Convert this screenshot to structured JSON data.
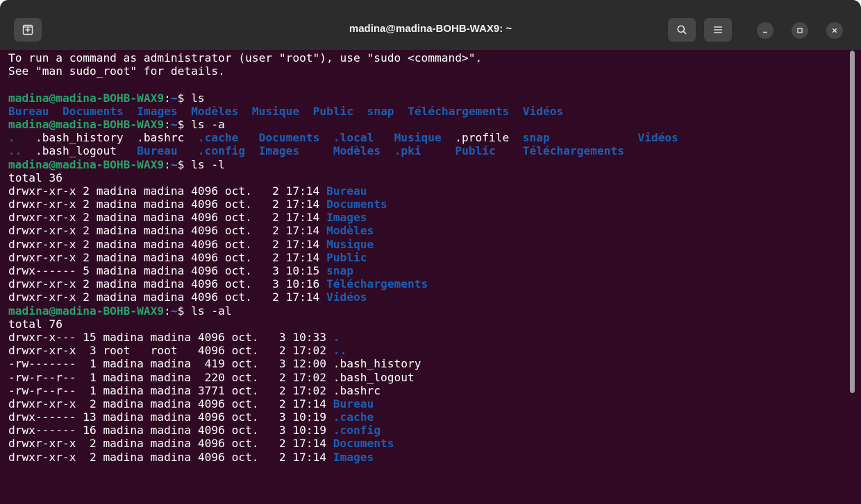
{
  "window": {
    "title": "madina@madina-BOHB-WAX9: ~"
  },
  "icons": {
    "new_tab": "new-tab-icon",
    "search": "search-icon",
    "menu": "hamburger-menu-icon",
    "minimize": "minimize-icon",
    "maximize": "maximize-icon",
    "close": "close-icon"
  },
  "colors": {
    "terminal_bg": "#300a24",
    "titlebar_bg": "#2c2c2c",
    "prompt_user": "#26a269",
    "prompt_path": "#3a79d8",
    "directory": "#1a5fb4",
    "text": "#ffffff"
  },
  "terminal": {
    "lines": [
      [
        {
          "t": "To run a command as administrator (user \"root\"), use \"sudo <command>\".",
          "c": "plain"
        }
      ],
      [
        {
          "t": "See \"man sudo_root\" for details.",
          "c": "plain"
        }
      ],
      [],
      [
        {
          "t": "madina@madina-BOHB-WAX9",
          "c": "prompt-user"
        },
        {
          "t": ":",
          "c": "plain"
        },
        {
          "t": "~",
          "c": "prompt-path"
        },
        {
          "t": "$ ls",
          "c": "plain"
        }
      ],
      [
        {
          "t": "Bureau",
          "c": "dir"
        },
        {
          "t": "  ",
          "c": "plain"
        },
        {
          "t": "Documents",
          "c": "dir"
        },
        {
          "t": "  ",
          "c": "plain"
        },
        {
          "t": "Images",
          "c": "dir"
        },
        {
          "t": "  ",
          "c": "plain"
        },
        {
          "t": "Modèles",
          "c": "dir"
        },
        {
          "t": "  ",
          "c": "plain"
        },
        {
          "t": "Musique",
          "c": "dir"
        },
        {
          "t": "  ",
          "c": "plain"
        },
        {
          "t": "Public",
          "c": "dir"
        },
        {
          "t": "  ",
          "c": "plain"
        },
        {
          "t": "snap",
          "c": "dir"
        },
        {
          "t": "  ",
          "c": "plain"
        },
        {
          "t": "Téléchargements",
          "c": "dir"
        },
        {
          "t": "  ",
          "c": "plain"
        },
        {
          "t": "Vidéos",
          "c": "dir"
        }
      ],
      [
        {
          "t": "madina@madina-BOHB-WAX9",
          "c": "prompt-user"
        },
        {
          "t": ":",
          "c": "plain"
        },
        {
          "t": "~",
          "c": "prompt-path"
        },
        {
          "t": "$ ls -a",
          "c": "plain"
        }
      ],
      [
        {
          "t": ".",
          "c": "dir"
        },
        {
          "t": "   .bash_history  .bashrc  ",
          "c": "plain"
        },
        {
          "t": ".cache",
          "c": "dir"
        },
        {
          "t": "   ",
          "c": "plain"
        },
        {
          "t": "Documents",
          "c": "dir"
        },
        {
          "t": "  ",
          "c": "plain"
        },
        {
          "t": ".local",
          "c": "dir"
        },
        {
          "t": "   ",
          "c": "plain"
        },
        {
          "t": "Musique",
          "c": "dir"
        },
        {
          "t": "  .profile  ",
          "c": "plain"
        },
        {
          "t": "snap",
          "c": "dir"
        },
        {
          "t": "             ",
          "c": "plain"
        },
        {
          "t": "Vidéos",
          "c": "dir"
        }
      ],
      [
        {
          "t": "..",
          "c": "dir"
        },
        {
          "t": "  .bash_logout   ",
          "c": "plain"
        },
        {
          "t": "Bureau",
          "c": "dir"
        },
        {
          "t": "   ",
          "c": "plain"
        },
        {
          "t": ".config",
          "c": "dir"
        },
        {
          "t": "  ",
          "c": "plain"
        },
        {
          "t": "Images",
          "c": "dir"
        },
        {
          "t": "     ",
          "c": "plain"
        },
        {
          "t": "Modèles",
          "c": "dir"
        },
        {
          "t": "  ",
          "c": "plain"
        },
        {
          "t": ".pki",
          "c": "dir"
        },
        {
          "t": "     ",
          "c": "plain"
        },
        {
          "t": "Public",
          "c": "dir"
        },
        {
          "t": "    ",
          "c": "plain"
        },
        {
          "t": "Téléchargements",
          "c": "dir"
        }
      ],
      [
        {
          "t": "madina@madina-BOHB-WAX9",
          "c": "prompt-user"
        },
        {
          "t": ":",
          "c": "plain"
        },
        {
          "t": "~",
          "c": "prompt-path"
        },
        {
          "t": "$ ls -l",
          "c": "plain"
        }
      ],
      [
        {
          "t": "total 36",
          "c": "plain"
        }
      ],
      [
        {
          "t": "drwxr-xr-x 2 madina madina 4096 oct.   2 17:14 ",
          "c": "plain"
        },
        {
          "t": "Bureau",
          "c": "dir"
        }
      ],
      [
        {
          "t": "drwxr-xr-x 2 madina madina 4096 oct.   2 17:14 ",
          "c": "plain"
        },
        {
          "t": "Documents",
          "c": "dir"
        }
      ],
      [
        {
          "t": "drwxr-xr-x 2 madina madina 4096 oct.   2 17:14 ",
          "c": "plain"
        },
        {
          "t": "Images",
          "c": "dir"
        }
      ],
      [
        {
          "t": "drwxr-xr-x 2 madina madina 4096 oct.   2 17:14 ",
          "c": "plain"
        },
        {
          "t": "Modèles",
          "c": "dir"
        }
      ],
      [
        {
          "t": "drwxr-xr-x 2 madina madina 4096 oct.   2 17:14 ",
          "c": "plain"
        },
        {
          "t": "Musique",
          "c": "dir"
        }
      ],
      [
        {
          "t": "drwxr-xr-x 2 madina madina 4096 oct.   2 17:14 ",
          "c": "plain"
        },
        {
          "t": "Public",
          "c": "dir"
        }
      ],
      [
        {
          "t": "drwx------ 5 madina madina 4096 oct.   3 10:15 ",
          "c": "plain"
        },
        {
          "t": "snap",
          "c": "dir"
        }
      ],
      [
        {
          "t": "drwxr-xr-x 2 madina madina 4096 oct.   3 10:16 ",
          "c": "plain"
        },
        {
          "t": "Téléchargements",
          "c": "dir"
        }
      ],
      [
        {
          "t": "drwxr-xr-x 2 madina madina 4096 oct.   2 17:14 ",
          "c": "plain"
        },
        {
          "t": "Vidéos",
          "c": "dir"
        }
      ],
      [
        {
          "t": "madina@madina-BOHB-WAX9",
          "c": "prompt-user"
        },
        {
          "t": ":",
          "c": "plain"
        },
        {
          "t": "~",
          "c": "prompt-path"
        },
        {
          "t": "$ ls -al",
          "c": "plain"
        }
      ],
      [
        {
          "t": "total 76",
          "c": "plain"
        }
      ],
      [
        {
          "t": "drwxr-x--- 15 madina madina 4096 oct.   3 10:33 ",
          "c": "plain"
        },
        {
          "t": ".",
          "c": "dir"
        }
      ],
      [
        {
          "t": "drwxr-xr-x  3 root   root   4096 oct.   2 17:02 ",
          "c": "plain"
        },
        {
          "t": "..",
          "c": "dir"
        }
      ],
      [
        {
          "t": "-rw-------  1 madina madina  419 oct.   3 12:00 .bash_history",
          "c": "plain"
        }
      ],
      [
        {
          "t": "-rw-r--r--  1 madina madina  220 oct.   2 17:02 .bash_logout",
          "c": "plain"
        }
      ],
      [
        {
          "t": "-rw-r--r--  1 madina madina 3771 oct.   2 17:02 .bashrc",
          "c": "plain"
        }
      ],
      [
        {
          "t": "drwxr-xr-x  2 madina madina 4096 oct.   2 17:14 ",
          "c": "plain"
        },
        {
          "t": "Bureau",
          "c": "dir"
        }
      ],
      [
        {
          "t": "drwx------ 13 madina madina 4096 oct.   3 10:19 ",
          "c": "plain"
        },
        {
          "t": ".cache",
          "c": "dir"
        }
      ],
      [
        {
          "t": "drwx------ 16 madina madina 4096 oct.   3 10:19 ",
          "c": "plain"
        },
        {
          "t": ".config",
          "c": "dir"
        }
      ],
      [
        {
          "t": "drwxr-xr-x  2 madina madina 4096 oct.   2 17:14 ",
          "c": "plain"
        },
        {
          "t": "Documents",
          "c": "dir"
        }
      ],
      [
        {
          "t": "drwxr-xr-x  2 madina madina 4096 oct.   2 17:14 ",
          "c": "plain"
        },
        {
          "t": "Images",
          "c": "dir"
        }
      ]
    ]
  }
}
